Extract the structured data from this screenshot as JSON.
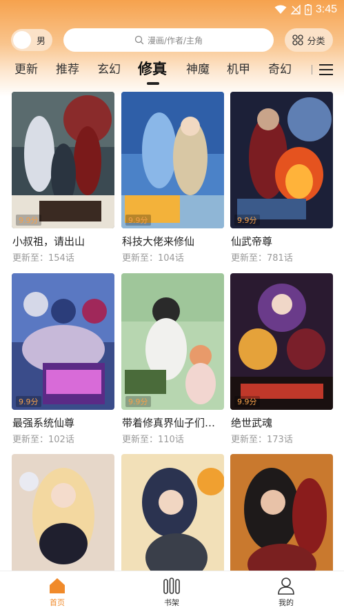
{
  "status": {
    "time": "3:45"
  },
  "header": {
    "gender_label": "男",
    "search_placeholder": "漫画/作者/主角",
    "category_label": "分类"
  },
  "tabs": [
    "更新",
    "推荐",
    "玄幻",
    "修真",
    "神魔",
    "机甲",
    "奇幻"
  ],
  "active_tab": "修真",
  "comics": [
    {
      "title": "小叔祖，请出山",
      "update": "更新至：154话",
      "score": "9.9分"
    },
    {
      "title": "科技大佬来修仙",
      "update": "更新至：104话",
      "score": "9.9分"
    },
    {
      "title": "仙武帝尊",
      "update": "更新至：781话",
      "score": "9.9分"
    },
    {
      "title": "最强系统仙尊",
      "update": "更新至：102话",
      "score": "9.9分"
    },
    {
      "title": "带着修真界仙子们天下无敌",
      "update": "更新至：110话",
      "score": "9.9分"
    },
    {
      "title": "绝世武魂",
      "update": "更新至：173话",
      "score": "9.9分"
    },
    {
      "title": "",
      "update": "",
      "score": ""
    },
    {
      "title": "",
      "update": "",
      "score": ""
    },
    {
      "title": "",
      "update": "",
      "score": ""
    }
  ],
  "bottom_nav": [
    {
      "label": "首页",
      "icon": "home-icon",
      "active": true
    },
    {
      "label": "书架",
      "icon": "bookshelf-icon",
      "active": false
    },
    {
      "label": "我的",
      "icon": "profile-icon",
      "active": false
    }
  ],
  "colors": {
    "accent": "#f08a2a",
    "header_orange": "#f6a24d",
    "score": "#f5a04a"
  }
}
